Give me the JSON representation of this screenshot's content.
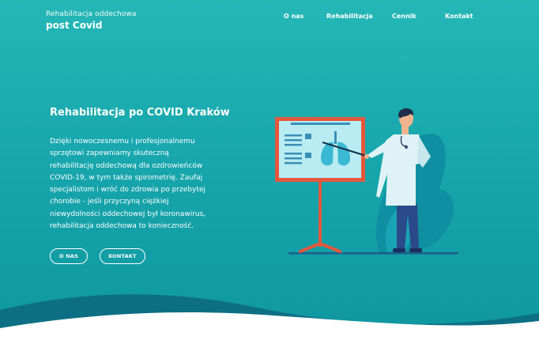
{
  "logo": {
    "subtitle": "Rehabilitacja oddechowa",
    "title": "post Covid"
  },
  "nav": {
    "items": [
      "O nas",
      "Rehabilitacja",
      "Cennik",
      "Kontakt"
    ]
  },
  "hero": {
    "title": "Rehabilitacja po COVID Kraków",
    "lines": [
      "Dzięki nowoczesnemu i profesjonalnemu",
      "sprzętowi zapewniamy skuteczną",
      "rehabilitację oddechową dla ozdrowieńców",
      "COVID-19, w tym także spirometrię. Zaufaj",
      "specjalistom i wróć do zdrowia po przebytej",
      "chorobie - jeśli przyczyną ciężkiej",
      "niewydolności oddechowej był koronawirus,",
      "rehabilitacja oddechowa to konieczność."
    ],
    "buttons": [
      "O NAS",
      "KONTAKT"
    ]
  },
  "colors": {
    "accent": "#e4573d",
    "teal": "#17a7ad",
    "screen": "#b9ecf2"
  },
  "icons": {
    "illustration": "doctor-presenting-lungs"
  }
}
